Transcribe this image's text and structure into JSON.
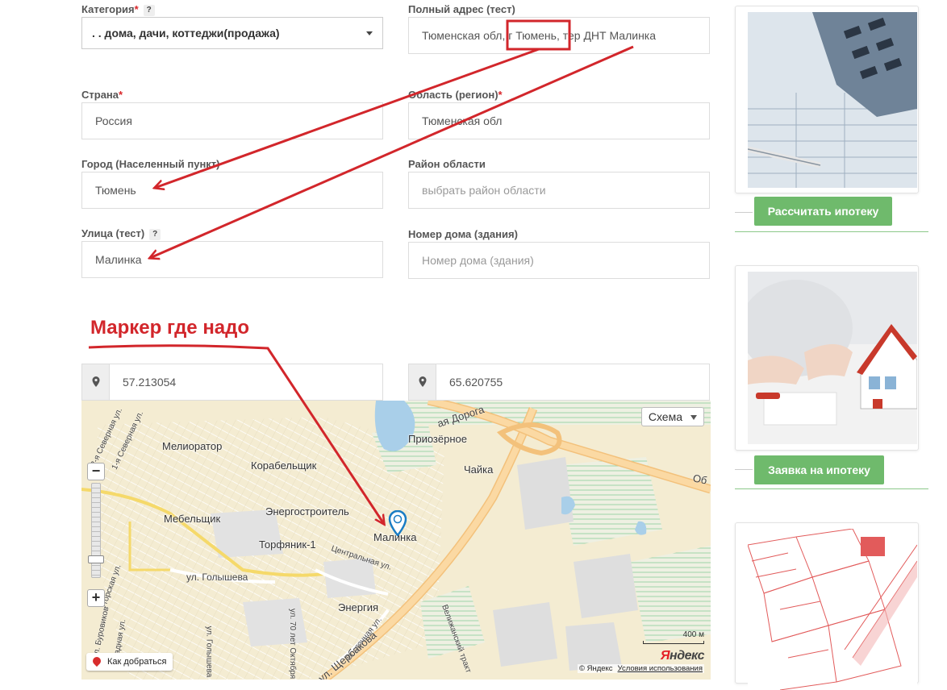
{
  "form": {
    "category": {
      "label": "Категория",
      "required_mark": "*",
      "help": "?",
      "value": ". . дома, дачи, коттеджи(продажа)"
    },
    "full_address": {
      "label": "Полный адрес (тест)",
      "value": "Тюменская обл, г Тюмень, тер ДНТ Малинка"
    },
    "country": {
      "label": "Страна",
      "required_mark": "*",
      "value": "Россия"
    },
    "region": {
      "label": "Область (регион)",
      "required_mark": "*",
      "value": "Тюменская обл"
    },
    "city": {
      "label": "Город (Населенный пункт)",
      "value": "Тюмень"
    },
    "district": {
      "label": "Район области",
      "placeholder": "выбрать район области"
    },
    "street": {
      "label": "Улица (тест)",
      "help": "?",
      "value": "Малинка"
    },
    "house": {
      "label": "Номер дома (здания)",
      "placeholder": "Номер дома (здания)"
    },
    "latitude": "57.213054",
    "longitude": "65.620755"
  },
  "annotation": {
    "text": "Маркер где надо",
    "color": "#d2262b"
  },
  "map": {
    "layer_button": "Схема",
    "places": [
      "Мелиоратор",
      "Корабельщик",
      "Мебельщик",
      "Энергостроитель",
      "Торфяник-1",
      "Малинка",
      "Приозёрное",
      "Чайка",
      "Энергия"
    ],
    "streets": [
      "ул. Голышева",
      "Центральная ул.",
      "Восточная ул.",
      "ул. Щербакова",
      "Велижанский тракт",
      "2-я Северная ул.",
      "1-я Северная ул.",
      "Угорская ул.",
      "ул. Буровиков",
      "ул. 70 лет Октября",
      "ул. Голышева",
      "Западная ул.",
      "ая Дорога",
      "Об"
    ],
    "zoom_in": "+",
    "zoom_out": "−",
    "scale": "400 м",
    "route_button": "Как добраться",
    "logo_y": "Я",
    "logo_rest": "ндекс",
    "copyright": "© Яндекс",
    "terms": "Условия использования"
  },
  "sidebar": {
    "mortgage_calc_button": "Рассчитать ипотеку",
    "mortgage_request_button": "Заявка на ипотеку"
  },
  "colors": {
    "accent_green": "#6fba6c",
    "annotation_red": "#d2262b",
    "map_marker": "#1a7cc4"
  }
}
